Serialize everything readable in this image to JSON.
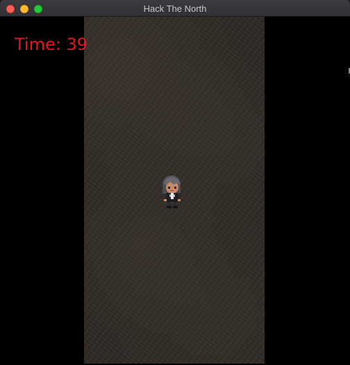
{
  "window": {
    "title": "Hack The North",
    "buttons": [
      "close",
      "minimize",
      "maximize"
    ]
  },
  "hud": {
    "timer_text": "Time: 39"
  },
  "scene": {
    "floor": "stone-corridor",
    "character": "player-sprite"
  },
  "colors": {
    "timer": "#e8141c",
    "background": "#000000",
    "floor": "#2e2924"
  }
}
